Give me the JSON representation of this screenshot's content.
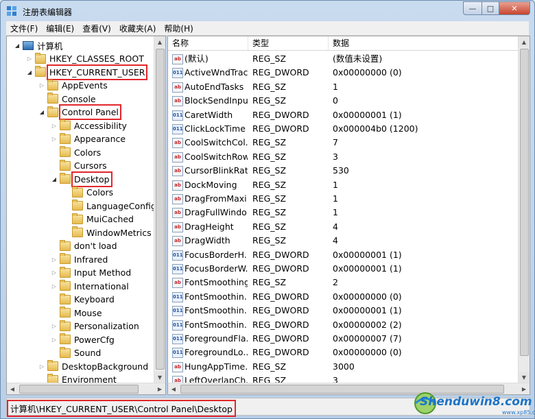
{
  "window": {
    "title": "注册表编辑器",
    "min_glyph": "—",
    "max_glyph": "□",
    "close_glyph": "✕"
  },
  "menu": [
    "文件(F)",
    "编辑(E)",
    "查看(V)",
    "收藏夹(A)",
    "帮助(H)"
  ],
  "tree": [
    {
      "label": "计算机",
      "depth": 0,
      "expander": "open",
      "icon": "computer-icon"
    },
    {
      "label": "HKEY_CLASSES_ROOT",
      "depth": 1,
      "expander": "closed",
      "icon": "folder-icon"
    },
    {
      "label": "HKEY_CURRENT_USER",
      "depth": 1,
      "expander": "open",
      "icon": "folder-icon",
      "highlight": true
    },
    {
      "label": "AppEvents",
      "depth": 2,
      "expander": "closed",
      "icon": "folder-icon"
    },
    {
      "label": "Console",
      "depth": 2,
      "expander": "none",
      "icon": "folder-icon"
    },
    {
      "label": "Control Panel",
      "depth": 2,
      "expander": "open",
      "icon": "folder-icon",
      "highlight": true
    },
    {
      "label": "Accessibility",
      "depth": 3,
      "expander": "closed",
      "icon": "folder-icon"
    },
    {
      "label": "Appearance",
      "depth": 3,
      "expander": "closed",
      "icon": "folder-icon"
    },
    {
      "label": "Colors",
      "depth": 3,
      "expander": "none",
      "icon": "folder-icon"
    },
    {
      "label": "Cursors",
      "depth": 3,
      "expander": "none",
      "icon": "folder-icon"
    },
    {
      "label": "Desktop",
      "depth": 3,
      "expander": "open",
      "icon": "folder-icon",
      "highlight": true,
      "selected": true
    },
    {
      "label": "Colors",
      "depth": 4,
      "expander": "none",
      "icon": "folder-icon"
    },
    {
      "label": "LanguageConfig",
      "depth": 4,
      "expander": "none",
      "icon": "folder-icon"
    },
    {
      "label": "MuiCached",
      "depth": 4,
      "expander": "none",
      "icon": "folder-icon"
    },
    {
      "label": "WindowMetrics",
      "depth": 4,
      "expander": "none",
      "icon": "folder-icon"
    },
    {
      "label": "don't load",
      "depth": 3,
      "expander": "none",
      "icon": "folder-icon"
    },
    {
      "label": "Infrared",
      "depth": 3,
      "expander": "closed",
      "icon": "folder-icon"
    },
    {
      "label": "Input Method",
      "depth": 3,
      "expander": "closed",
      "icon": "folder-icon"
    },
    {
      "label": "International",
      "depth": 3,
      "expander": "closed",
      "icon": "folder-icon"
    },
    {
      "label": "Keyboard",
      "depth": 3,
      "expander": "none",
      "icon": "folder-icon"
    },
    {
      "label": "Mouse",
      "depth": 3,
      "expander": "none",
      "icon": "folder-icon"
    },
    {
      "label": "Personalization",
      "depth": 3,
      "expander": "closed",
      "icon": "folder-icon"
    },
    {
      "label": "PowerCfg",
      "depth": 3,
      "expander": "closed",
      "icon": "folder-icon"
    },
    {
      "label": "Sound",
      "depth": 3,
      "expander": "none",
      "icon": "folder-icon"
    },
    {
      "label": "DesktopBackground",
      "depth": 2,
      "expander": "closed",
      "icon": "folder-icon"
    },
    {
      "label": "Environment",
      "depth": 2,
      "expander": "none",
      "icon": "folder-icon"
    }
  ],
  "columns": [
    "名称",
    "类型",
    "数据"
  ],
  "values": [
    {
      "name": "(默认)",
      "type": "REG_SZ",
      "data": "(数值未设置)",
      "icon": "string-value-icon"
    },
    {
      "name": "ActiveWndTrac...",
      "type": "REG_DWORD",
      "data": "0x00000000 (0)",
      "icon": "binary-value-icon"
    },
    {
      "name": "AutoEndTasks",
      "type": "REG_SZ",
      "data": "1",
      "icon": "string-value-icon"
    },
    {
      "name": "BlockSendInpu...",
      "type": "REG_SZ",
      "data": "0",
      "icon": "string-value-icon"
    },
    {
      "name": "CaretWidth",
      "type": "REG_DWORD",
      "data": "0x00000001 (1)",
      "icon": "binary-value-icon"
    },
    {
      "name": "ClickLockTime",
      "type": "REG_DWORD",
      "data": "0x000004b0 (1200)",
      "icon": "binary-value-icon"
    },
    {
      "name": "CoolSwitchCol...",
      "type": "REG_SZ",
      "data": "7",
      "icon": "string-value-icon"
    },
    {
      "name": "CoolSwitchRows",
      "type": "REG_SZ",
      "data": "3",
      "icon": "string-value-icon"
    },
    {
      "name": "CursorBlinkRate",
      "type": "REG_SZ",
      "data": "530",
      "icon": "string-value-icon"
    },
    {
      "name": "DockMoving",
      "type": "REG_SZ",
      "data": "1",
      "icon": "string-value-icon"
    },
    {
      "name": "DragFromMaxi...",
      "type": "REG_SZ",
      "data": "1",
      "icon": "string-value-icon"
    },
    {
      "name": "DragFullWindo...",
      "type": "REG_SZ",
      "data": "1",
      "icon": "string-value-icon"
    },
    {
      "name": "DragHeight",
      "type": "REG_SZ",
      "data": "4",
      "icon": "string-value-icon"
    },
    {
      "name": "DragWidth",
      "type": "REG_SZ",
      "data": "4",
      "icon": "string-value-icon"
    },
    {
      "name": "FocusBorderH...",
      "type": "REG_DWORD",
      "data": "0x00000001 (1)",
      "icon": "binary-value-icon"
    },
    {
      "name": "FocusBorderW...",
      "type": "REG_DWORD",
      "data": "0x00000001 (1)",
      "icon": "binary-value-icon"
    },
    {
      "name": "FontSmoothing",
      "type": "REG_SZ",
      "data": "2",
      "icon": "string-value-icon"
    },
    {
      "name": "FontSmoothin...",
      "type": "REG_DWORD",
      "data": "0x00000000 (0)",
      "icon": "binary-value-icon"
    },
    {
      "name": "FontSmoothin...",
      "type": "REG_DWORD",
      "data": "0x00000001 (1)",
      "icon": "binary-value-icon"
    },
    {
      "name": "FontSmoothin...",
      "type": "REG_DWORD",
      "data": "0x00000002 (2)",
      "icon": "binary-value-icon"
    },
    {
      "name": "ForegroundFla...",
      "type": "REG_DWORD",
      "data": "0x00000007 (7)",
      "icon": "binary-value-icon"
    },
    {
      "name": "ForegroundLo...",
      "type": "REG_DWORD",
      "data": "0x00000000 (0)",
      "icon": "binary-value-icon"
    },
    {
      "name": "HungAppTime...",
      "type": "REG_SZ",
      "data": "3000",
      "icon": "string-value-icon"
    },
    {
      "name": "LeftOverlapCh...",
      "type": "REG_SZ",
      "data": "3",
      "icon": "string-value-icon"
    }
  ],
  "status": {
    "path": "计算机\\HKEY_CURRENT_USER\\Control Panel\\Desktop"
  },
  "watermark": {
    "text": "Shenduwin8.com",
    "sub": "www.xp85.com"
  }
}
